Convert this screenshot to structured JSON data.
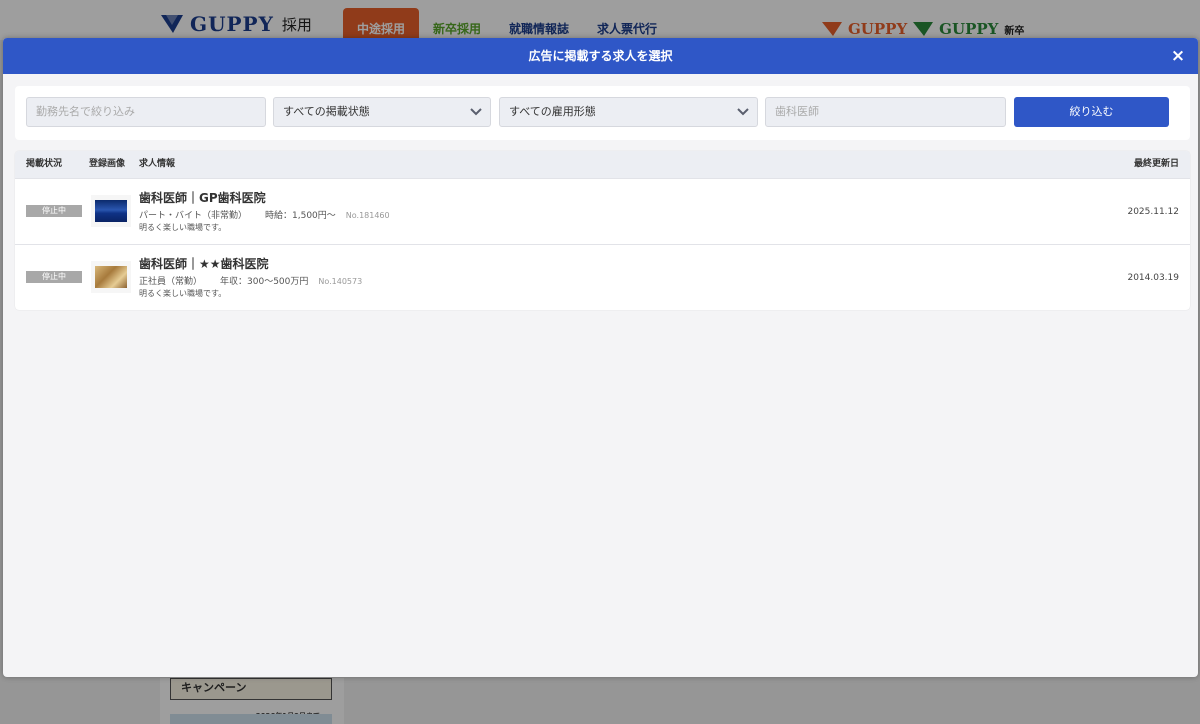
{
  "background": {
    "logo_word": "GUPPY",
    "logo_sub": "採用",
    "nav": [
      "中途採用",
      "新卒採用",
      "就職情報誌",
      "求人票代行"
    ],
    "brand_a": "GUPPY",
    "brand_b": "GUPPY",
    "brand_b_sub": "新卒",
    "banner_text": "キャンペーン",
    "banner_date": "2026年1月9日まで"
  },
  "modal": {
    "title": "広告に掲載する求人を選択",
    "close_label": "×"
  },
  "filters": {
    "workplace_placeholder": "勤務先名で絞り込み",
    "status_select": "すべての掲載状態",
    "employment_select": "すべての雇用形態",
    "occupation_placeholder": "歯科医師",
    "submit_label": "絞り込む"
  },
  "table": {
    "columns": {
      "status": "掲載状況",
      "image": "登録画像",
      "info": "求人情報",
      "updated": "最終更新日"
    },
    "rows": [
      {
        "status": "停止中",
        "title": "歯科医師｜GP歯科医院",
        "employment": "パート・バイト（非常勤）",
        "salary": "時給：1,500円〜",
        "no": "No.181460",
        "description": "明るく楽しい職場です。",
        "updated": "2025.11.12"
      },
      {
        "status": "停止中",
        "title": "歯科医師｜★★歯科医院",
        "employment": "正社員（常勤）",
        "salary": "年収：300〜500万円",
        "no": "No.140573",
        "description": "明るく楽しい職場です。",
        "updated": "2014.03.19"
      }
    ]
  },
  "colors": {
    "primary": "#2f57c7",
    "badge_stopped": "#a8a8a8",
    "nav_active": "#e8602a"
  }
}
